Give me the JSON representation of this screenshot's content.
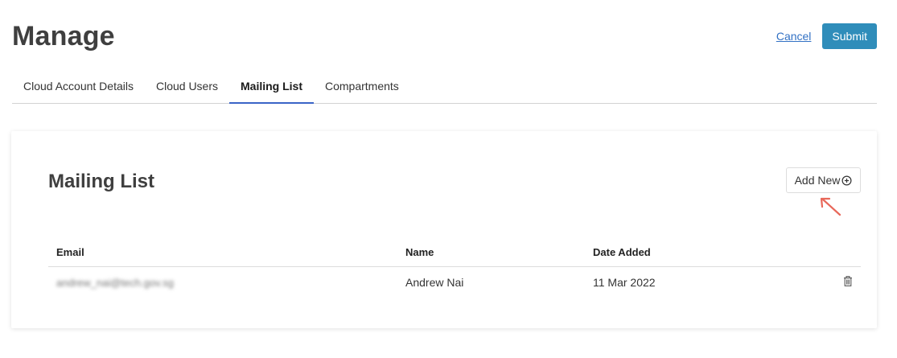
{
  "header": {
    "title": "Manage",
    "cancel_label": "Cancel",
    "submit_label": "Submit"
  },
  "tabs": [
    {
      "label": "Cloud Account Details",
      "active": false
    },
    {
      "label": "Cloud Users",
      "active": false
    },
    {
      "label": "Mailing List",
      "active": true
    },
    {
      "label": "Compartments",
      "active": false
    }
  ],
  "card": {
    "title": "Mailing List",
    "add_new_label": "Add New",
    "add_new_icon": "plus-circle-icon"
  },
  "table": {
    "columns": [
      "Email",
      "Name",
      "Date Added"
    ],
    "rows": [
      {
        "email": "andrew_nai@tech.gov.sg",
        "name": "Andrew Nai",
        "date_added": "11 Mar 2022",
        "action_icon": "trash-icon"
      }
    ]
  },
  "colors": {
    "submit_bg": "#2f8dba",
    "link": "#3271c4",
    "active_tab_underline": "#3a64c7",
    "annotation_arrow": "#e8685a"
  }
}
